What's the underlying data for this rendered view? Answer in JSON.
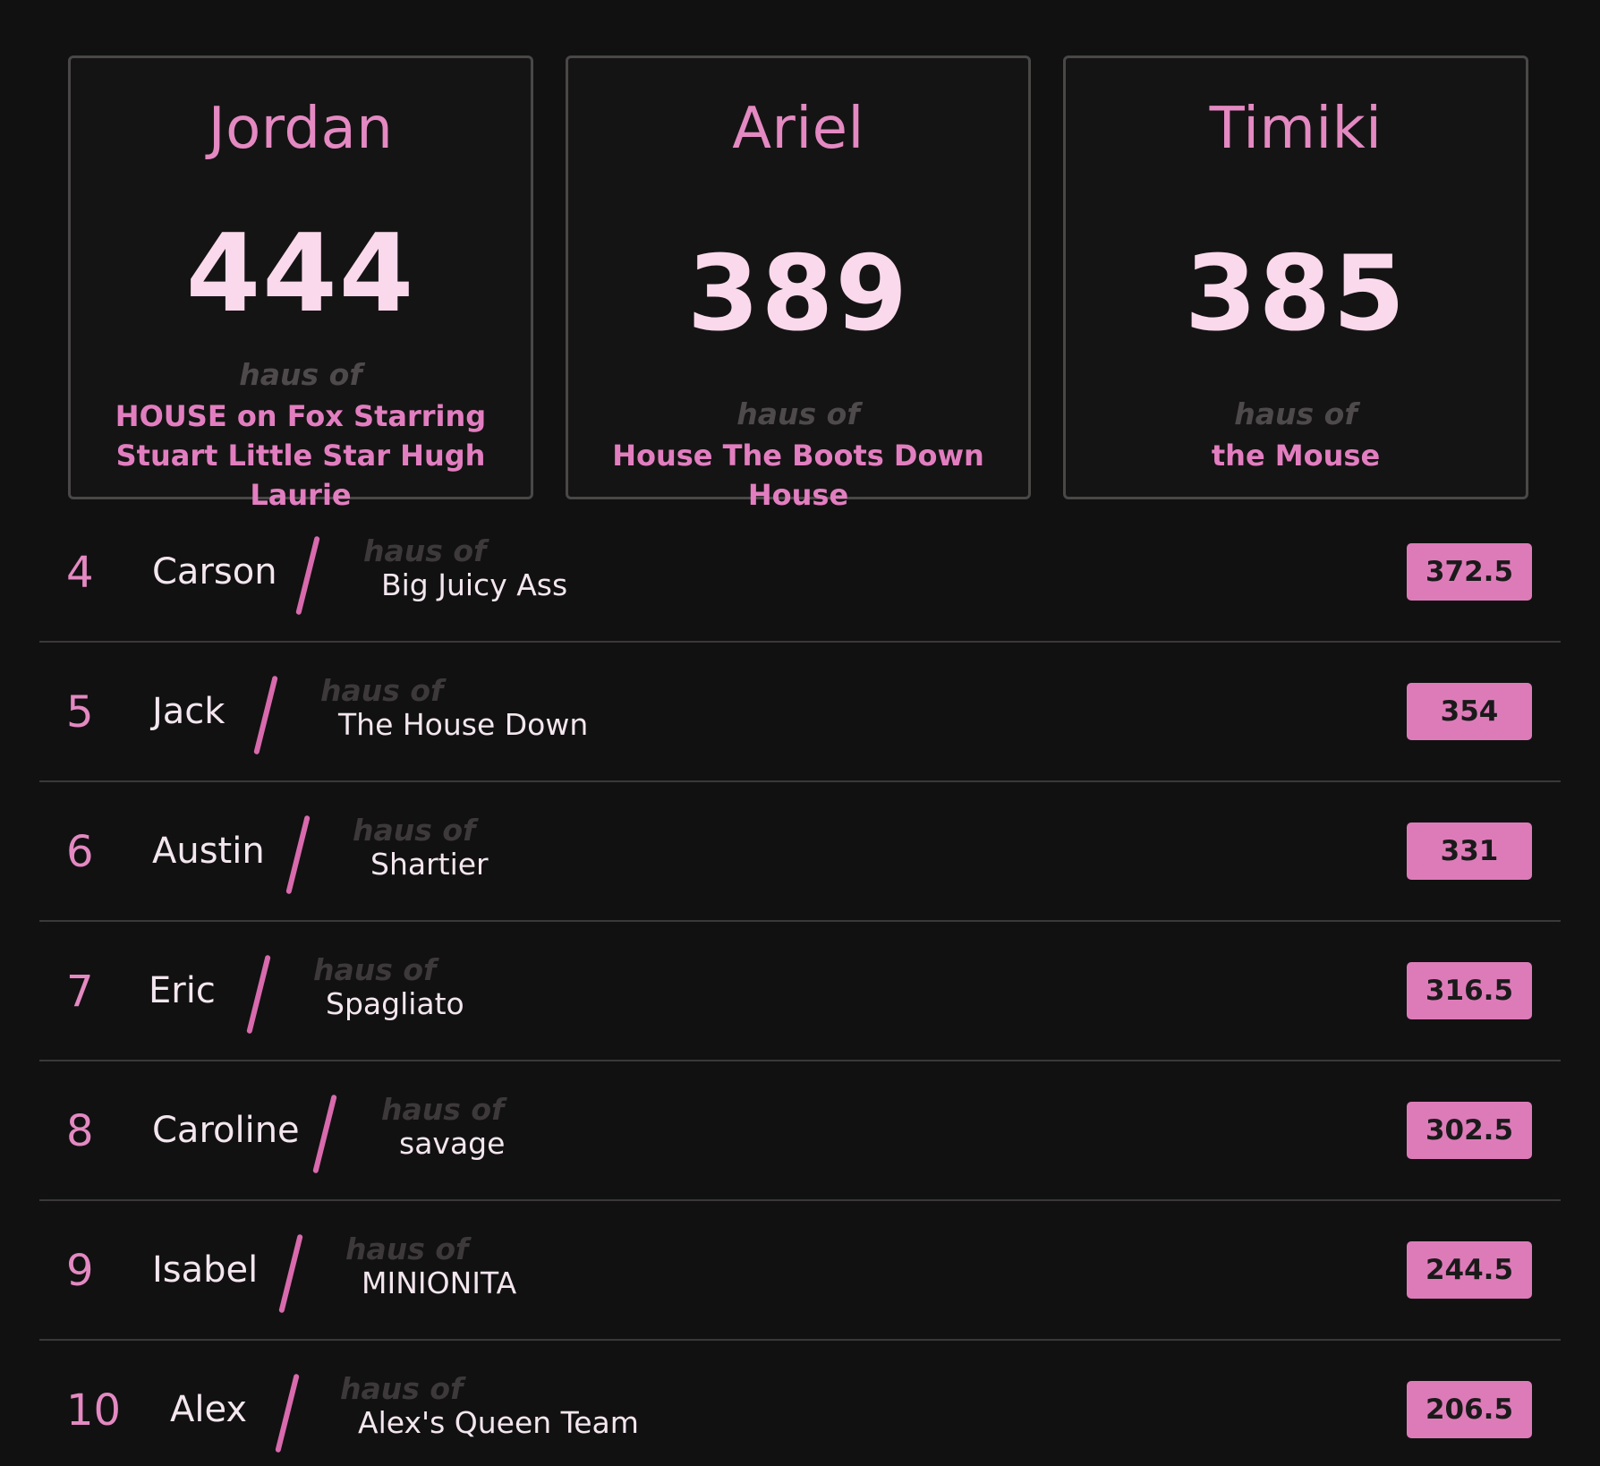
{
  "podium": [
    {
      "name": "Jordan",
      "score": "444",
      "haus_label": "haus of",
      "haus": "HOUSE on Fox Starring Stuart Little Star Hugh Laurie"
    },
    {
      "name": "Ariel",
      "score": "389",
      "haus_label": "haus of",
      "haus": "House The Boots Down House"
    },
    {
      "name": "Timiki",
      "score": "385",
      "haus_label": "haus of",
      "haus": "the Mouse"
    }
  ],
  "rows": [
    {
      "rank": "4",
      "name": "Carson",
      "haus_label": "haus of",
      "haus": "Big Juicy Ass",
      "score": "372.5"
    },
    {
      "rank": "5",
      "name": "Jack",
      "haus_label": "haus of",
      "haus": "The House Down",
      "score": "354"
    },
    {
      "rank": "6",
      "name": "Austin",
      "haus_label": "haus of",
      "haus": "Shartier",
      "score": "331"
    },
    {
      "rank": "7",
      "name": "Eric",
      "haus_label": "haus of",
      "haus": "Spagliato",
      "score": "316.5"
    },
    {
      "rank": "8",
      "name": "Caroline",
      "haus_label": "haus of",
      "haus": "savage",
      "score": "302.5"
    },
    {
      "rank": "9",
      "name": "Isabel",
      "haus_label": "haus of",
      "haus": "MINIONITA",
      "score": "244.5"
    },
    {
      "rank": "10",
      "name": "Alex",
      "haus_label": "haus of",
      "haus": "Alex's Queen Team",
      "score": "206.5"
    }
  ],
  "colors": {
    "background": "#111111",
    "accent": "#e489c2",
    "badge": "#dd7bb9",
    "podium_score": "#fbd9ec"
  }
}
